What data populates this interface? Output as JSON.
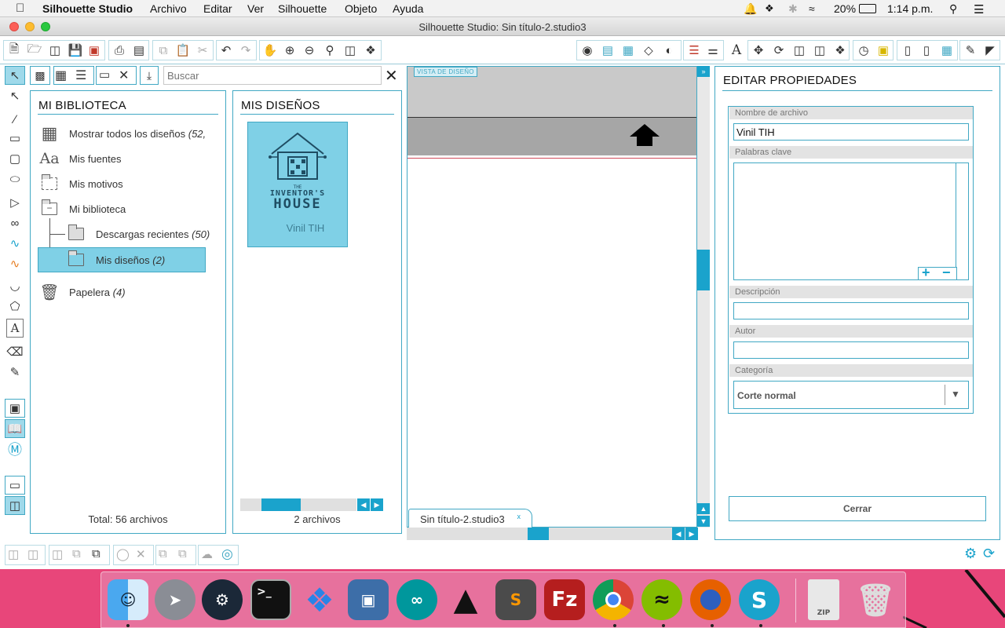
{
  "menubar": {
    "apple_icon": "apple-icon",
    "app_name": "Silhouette Studio",
    "items": [
      "Archivo",
      "Editar",
      "Ver",
      "Silhouette",
      "Objeto",
      "Ayuda"
    ],
    "battery": "20%",
    "time": "1:14 p.m."
  },
  "window": {
    "title": "Silhouette Studio: Sin título-2.studio3"
  },
  "library": {
    "search_placeholder": "Buscar",
    "title": "MI BIBLIOTECA",
    "items": [
      {
        "label": "Mostrar todos los diseños",
        "count": "(52,"
      },
      {
        "label": "Mis fuentes",
        "count": ""
      },
      {
        "label": "Mis motivos",
        "count": ""
      },
      {
        "label": "Mi biblioteca",
        "count": ""
      },
      {
        "label": "Descargas recientes",
        "count": "(50)"
      },
      {
        "label": "Mis diseños",
        "count": "(2)"
      },
      {
        "label": "Papelera",
        "count": "(4)"
      }
    ],
    "total": "Total: 56 archivos"
  },
  "designs": {
    "title": "MIS DISEÑOS",
    "card_logo_line1": "THE",
    "card_logo_line2": "INVENTOR'S",
    "card_logo_line3": "HOUSE",
    "card_label": "Vinil TIH",
    "count": "2 archivos"
  },
  "canvas": {
    "view_label": "VISTA DE DISEÑO",
    "tab_label": "Sin título-2.studio3",
    "tab_close": "x"
  },
  "properties": {
    "title": "EDITAR PROPIEDADES",
    "filename_label": "Nombre de archivo",
    "filename_value": "Vinil TIH",
    "keywords_label": "Palabras clave",
    "description_label": "Descripción",
    "author_label": "Autor",
    "category_label": "Categoría",
    "category_value": "Corte normal",
    "close_label": "Cerrar"
  },
  "colors": {
    "accent": "#41a8c4",
    "selection": "#7fd0e6",
    "desktop": "#e8467a"
  }
}
